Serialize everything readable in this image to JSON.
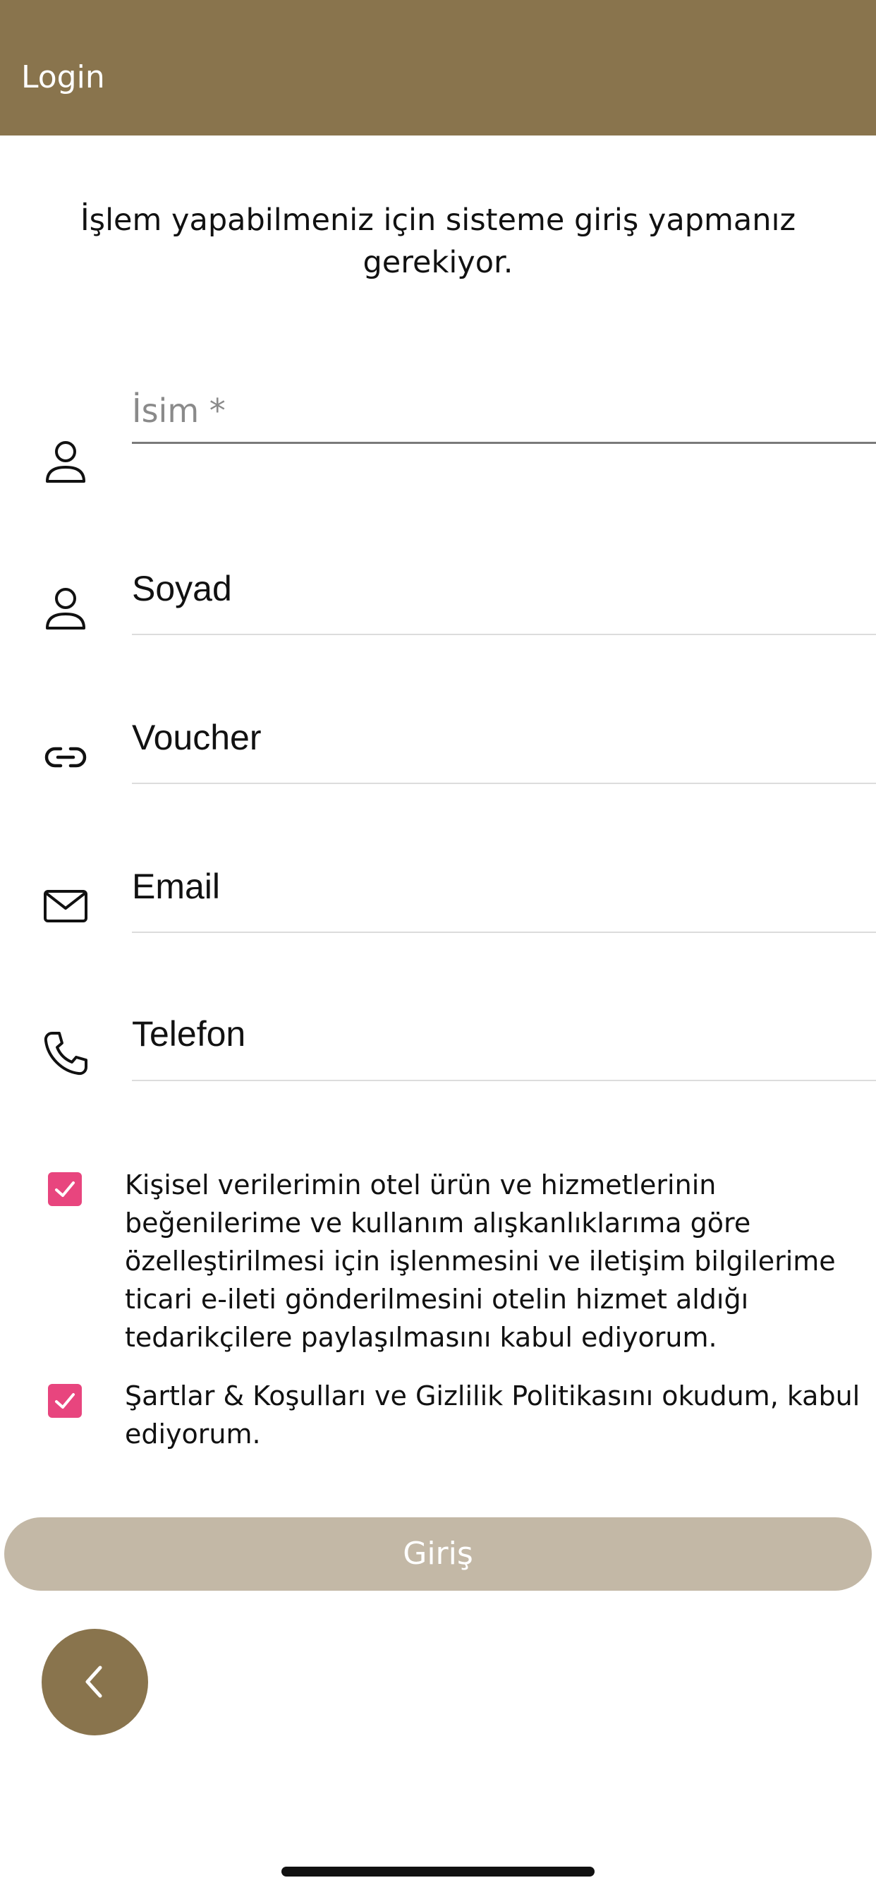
{
  "header": {
    "title": "Login",
    "background_color": "#89744d"
  },
  "intro": {
    "text": "İşlem yapabilmeniz için sisteme giriş yapmanız gerekiyor."
  },
  "form": {
    "fields": [
      {
        "placeholder": "İsim *",
        "value": "",
        "icon": "user-icon"
      },
      {
        "placeholder": "Soyad",
        "value": "",
        "icon": "user-icon"
      },
      {
        "placeholder": "Voucher",
        "value": "",
        "icon": "link-icon"
      },
      {
        "placeholder": "Email",
        "value": "",
        "icon": "mail-icon"
      },
      {
        "placeholder": "Telefon",
        "value": "",
        "icon": "phone-icon"
      }
    ]
  },
  "consents": [
    {
      "checked": true,
      "text": "Kişisel verilerimin otel ürün ve hizmetlerinin beğenilerime ve kullanım alışkanlıklarıma göre özelleştirilmesi için işlenmesini ve iletişim bilgilerime ticari e-ileti gönderilmesini otelin hizmet aldığı tedarikçilere paylaşılmasını kabul ediyorum."
    },
    {
      "checked": true,
      "text": "Şartlar & Koşulları ve Gizlilik Politikasını okudum, kabul ediyorum."
    }
  ],
  "actions": {
    "submit_label": "Giriş",
    "submit_color": "#c3b8a6",
    "back_icon": "chevron-left-icon",
    "back_color": "#89744d"
  },
  "accent_color": "#e8457e"
}
